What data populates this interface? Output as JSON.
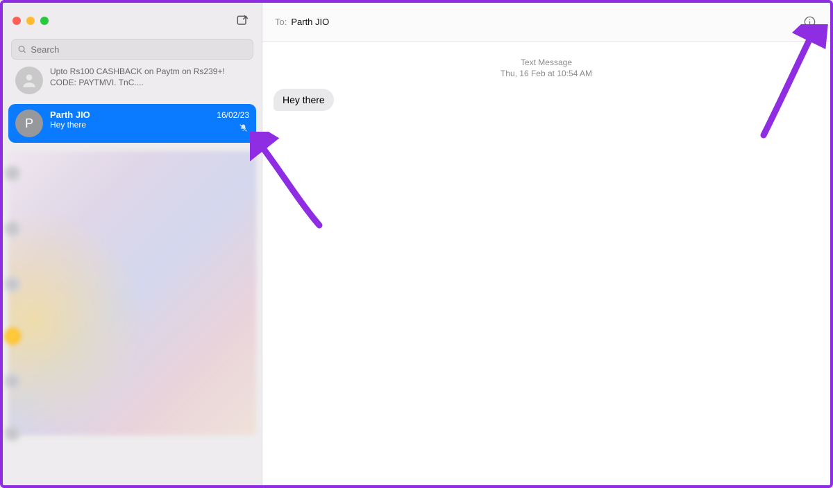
{
  "window": {
    "traffic": {
      "close": "close",
      "minimize": "minimize",
      "zoom": "zoom"
    }
  },
  "sidebar": {
    "search_placeholder": "Search",
    "items": [
      {
        "name": "",
        "preview": "Upto Rs100 CASHBACK on Paytm on Rs239+! CODE: PAYTMVI. TnC....",
        "date": ""
      },
      {
        "name": "Parth JIO",
        "preview": "Hey there",
        "date": "16/02/23",
        "avatar_letter": "P",
        "muted": true,
        "selected": true
      }
    ]
  },
  "header": {
    "to_label": "To:",
    "recipient": "Parth JIO"
  },
  "thread": {
    "meta_line1": "Text Message",
    "meta_line2": "Thu, 16 Feb at 10:54 AM",
    "messages": [
      {
        "text": "Hey there",
        "outgoing": false
      }
    ]
  },
  "icons": {
    "compose": "compose-icon",
    "search": "search-icon",
    "info": "info-icon",
    "mute": "bell-slash-icon"
  }
}
